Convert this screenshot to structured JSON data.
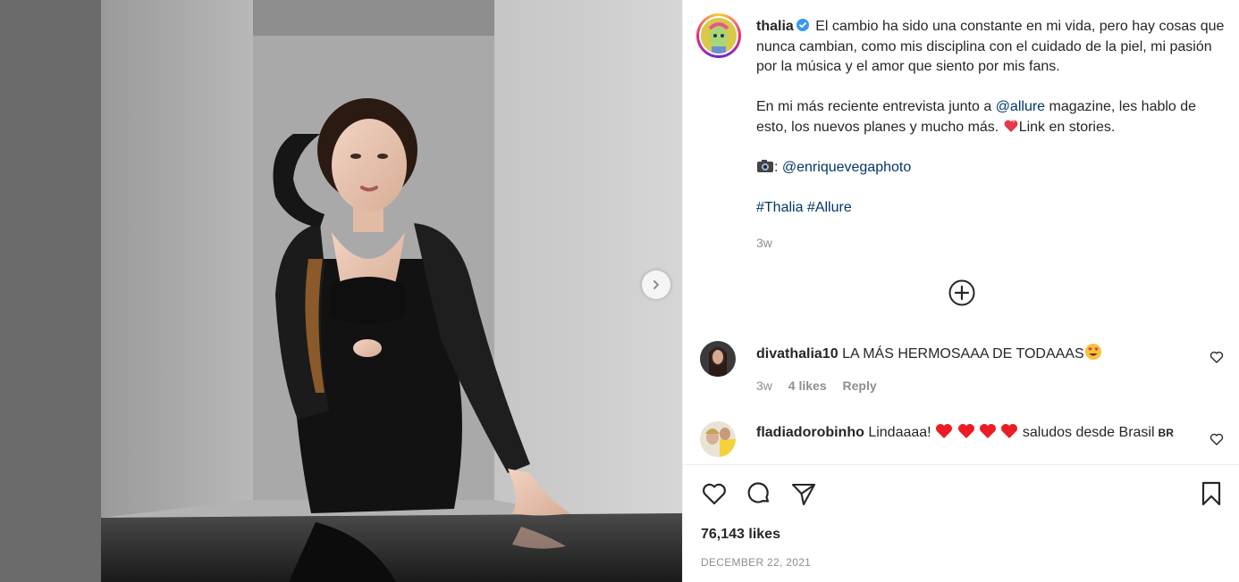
{
  "post": {
    "username": "thalia",
    "caption_line1": "El cambio ha sido una constante en mi vida, pero hay cosas que nunca cambian, como mis disciplina con el cuidado de la piel, mi pasión por la música y el amor que siento por mis fans.",
    "caption_p2_before": "En mi más reciente entrevista junto a ",
    "caption_p2_mention": "@allure",
    "caption_p2_after": " magazine, les hablo de esto, los nuevos planes y mucho más. ",
    "caption_p2_end": "Link en stories.",
    "caption_p3_prefix": ": ",
    "caption_p3_mention": "@enriquevegaphoto",
    "hashtags": "#Thalia #Allure",
    "time": "3w"
  },
  "comments": [
    {
      "username": "divathalia10",
      "text": "LA MÁS HERMOSAAA DE TODAAAS",
      "time": "3w",
      "likes": "4 likes",
      "reply": "Reply"
    },
    {
      "username": "fladiadorobinho",
      "text_before": "Lindaaaa!",
      "text_after": "saludos desde Brasil",
      "flag_text": "BR"
    }
  ],
  "footer": {
    "likes": "76,143 likes",
    "date": "DECEMBER 22, 2021"
  },
  "icons": {
    "verified": "verified-badge-icon",
    "next": "chevron-right-icon",
    "add": "plus-circle-icon",
    "like": "heart-icon",
    "comment": "comment-icon",
    "share": "paper-plane-icon",
    "save": "bookmark-icon"
  },
  "colors": {
    "link": "#00376b",
    "verified": "#3897f0",
    "muted": "#8e8e8e",
    "heart_red": "#ed1c24"
  }
}
